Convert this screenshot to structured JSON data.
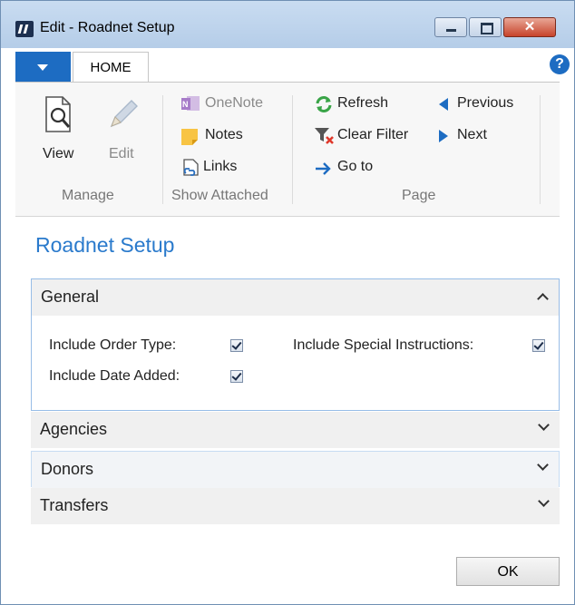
{
  "window": {
    "title": "Edit - Roadnet Setup",
    "close_glyph": "✕"
  },
  "ribbon": {
    "tab_home": "HOME",
    "help_glyph": "?",
    "manage": {
      "label": "Manage",
      "view": "View",
      "edit": "Edit"
    },
    "show_attached": {
      "label": "Show Attached",
      "onenote": "OneNote",
      "notes": "Notes",
      "links": "Links"
    },
    "page": {
      "label": "Page",
      "refresh": "Refresh",
      "clear_filter": "Clear Filter",
      "go_to": "Go to",
      "previous": "Previous",
      "next": "Next"
    }
  },
  "page_title": "Roadnet Setup",
  "sections": {
    "general": {
      "title": "General",
      "fields": {
        "include_order_type": {
          "label": "Include Order Type:",
          "checked": true
        },
        "include_date_added": {
          "label": "Include Date Added:",
          "checked": true
        },
        "include_special_instructions": {
          "label": "Include Special Instructions:",
          "checked": true
        }
      }
    },
    "agencies": {
      "title": "Agencies"
    },
    "donors": {
      "title": "Donors"
    },
    "transfers": {
      "title": "Transfers"
    }
  },
  "ok_button": "OK",
  "colors": {
    "accent": "#1d6cc2",
    "title_blue": "#2a7acc",
    "section_border": "#98bde7"
  }
}
